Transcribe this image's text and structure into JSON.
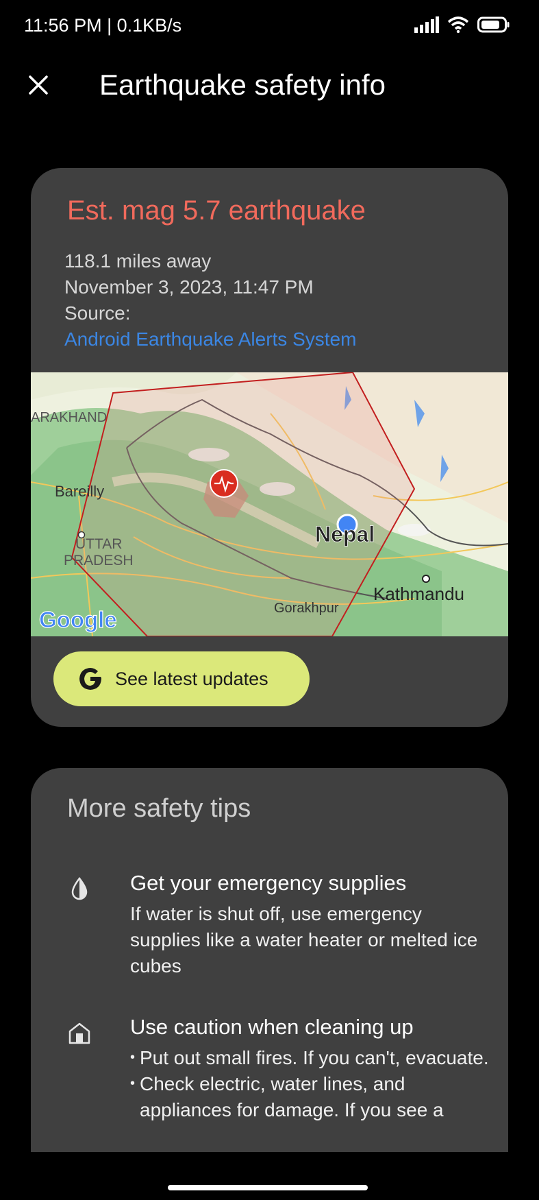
{
  "status": {
    "time": "11:56 PM | 0.1KB/s"
  },
  "appbar": {
    "title": "Earthquake safety info",
    "close_icon": "close-icon"
  },
  "alert": {
    "title": "Est. mag 5.7 earthquake",
    "distance": "118.1 miles away",
    "datetime": "November 3, 2023, 11:47 PM",
    "source_label": "Source:",
    "source_link": "Android Earthquake Alerts System",
    "title_color": "#f16a5c",
    "link_color": "#3b86e3"
  },
  "map": {
    "labels": {
      "region1": "ARAKHAND",
      "city1": "Bareilly",
      "region2a": "UTTAR",
      "region2b": "PRADESH",
      "country": "Nepal",
      "city2": "Gorakhpur",
      "city3": "Kathmandu",
      "attribution": "Google"
    }
  },
  "updates_button": {
    "label": "See latest updates",
    "color": "#dbe87a"
  },
  "tips": {
    "heading": "More safety tips",
    "items": [
      {
        "icon": "water-drop-icon",
        "title": "Get your emergency supplies",
        "body": "If water is shut off, use emergency supplies like a water heater or melted ice cubes"
      },
      {
        "icon": "house-icon",
        "title": "Use caution when cleaning up",
        "bullets": [
          "Put out small fires. If you can't, evacuate.",
          "Check electric, water lines, and appliances for damage. If you see a"
        ]
      }
    ]
  }
}
